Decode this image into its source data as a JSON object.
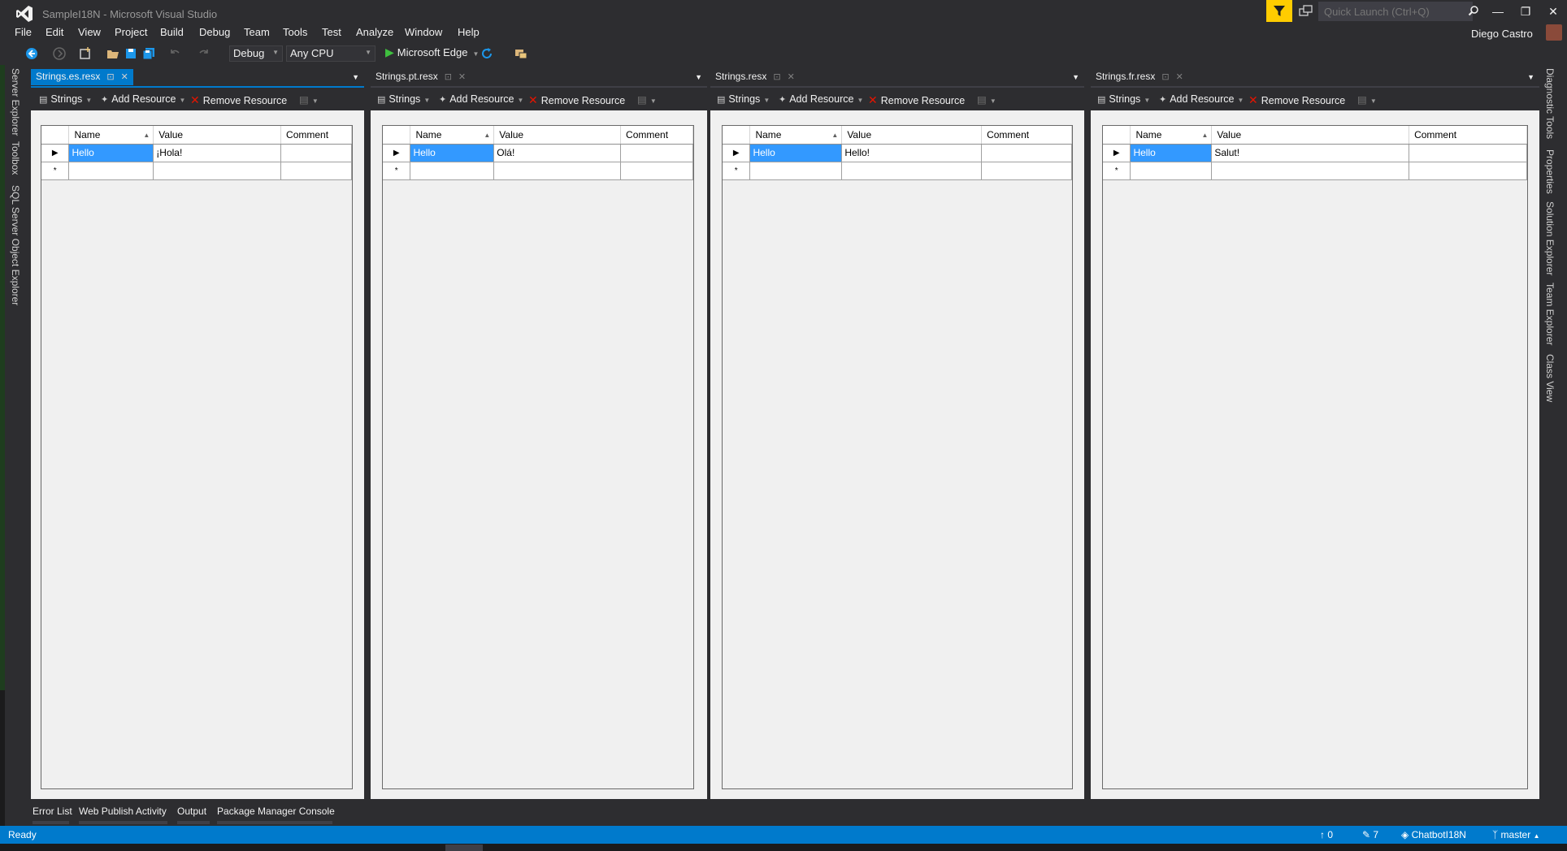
{
  "window": {
    "title": "SampleI18N - Microsoft Visual Studio",
    "quick_launch_placeholder": "Quick Launch (Ctrl+Q)",
    "user": "Diego Castro"
  },
  "menu": [
    "File",
    "Edit",
    "View",
    "Project",
    "Build",
    "Debug",
    "Team",
    "Tools",
    "Test",
    "Analyze",
    "Window",
    "Help"
  ],
  "toolbar": {
    "configuration": "Debug",
    "platform": "Any CPU",
    "run_target": "Microsoft Edge"
  },
  "left_tool_windows": [
    "Server Explorer",
    "Toolbox",
    "SQL Server Object Explorer"
  ],
  "right_tool_windows": [
    "Diagnostic Tools",
    "Properties",
    "Solution Explorer",
    "Team Explorer",
    "Class View"
  ],
  "editor_toolbar": {
    "resource_type": "Strings",
    "add_resource": "Add Resource",
    "remove_resource": "Remove Resource"
  },
  "grid_columns": [
    "Name",
    "Value",
    "Comment"
  ],
  "documents": [
    {
      "tab": "Strings.es.resx",
      "active": true,
      "rows": [
        {
          "name": "Hello",
          "value": "¡Hola!",
          "comment": ""
        }
      ]
    },
    {
      "tab": "Strings.pt.resx",
      "active": false,
      "rows": [
        {
          "name": "Hello",
          "value": "Olá!",
          "comment": ""
        }
      ]
    },
    {
      "tab": "Strings.resx",
      "active": false,
      "rows": [
        {
          "name": "Hello",
          "value": "Hello!",
          "comment": ""
        }
      ]
    },
    {
      "tab": "Strings.fr.resx",
      "active": false,
      "rows": [
        {
          "name": "Hello",
          "value": "Salut!",
          "comment": ""
        }
      ]
    }
  ],
  "new_row_marker": "*",
  "bottom_tabs": [
    "Error List",
    "Web Publish Activity",
    "Output",
    "Package Manager Console"
  ],
  "status": {
    "text": "Ready",
    "up_count": "0",
    "pending_changes": "7",
    "repo": "ChatbotI18N",
    "branch": "master"
  },
  "colors": {
    "accent": "#007acc",
    "selection": "#3399ff",
    "remove_icon": "#e51400",
    "filter_badge": "#ffcc00",
    "run_icon": "#3fbf3f"
  }
}
